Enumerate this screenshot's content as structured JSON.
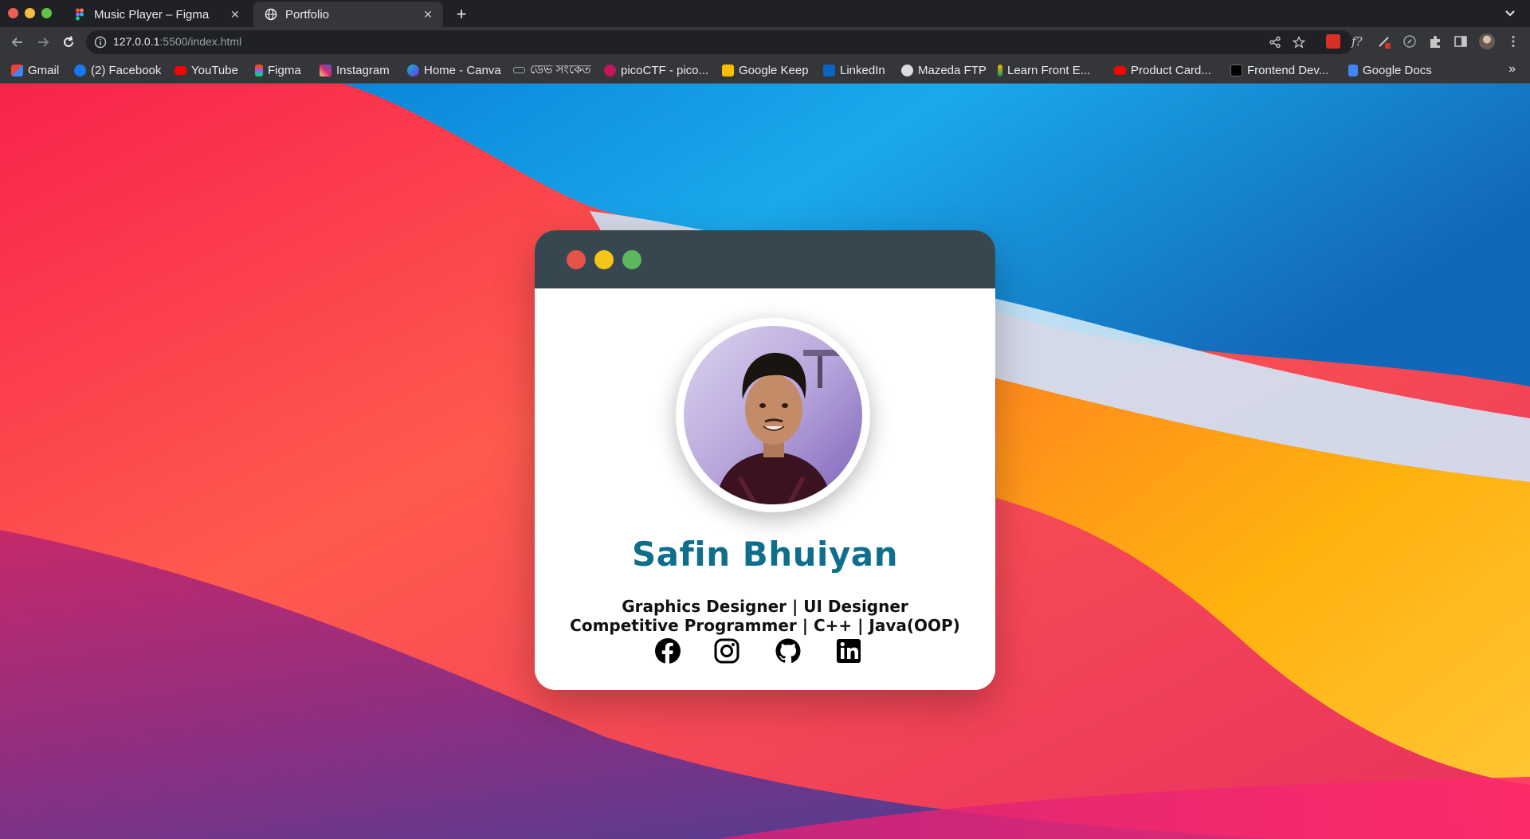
{
  "browser": {
    "tabs": [
      {
        "title": "Music Player – Figma",
        "icon": "figma-icon",
        "active": false
      },
      {
        "title": "Portfolio",
        "icon": "globe-icon",
        "active": true
      }
    ],
    "url_host": "127.0.0.1",
    "url_path": ":5500/index.html",
    "bookmarks": [
      {
        "label": "Gmail",
        "icon": "gmail-icon"
      },
      {
        "label": "(2) Facebook",
        "icon": "facebook-icon"
      },
      {
        "label": "YouTube",
        "icon": "youtube-icon"
      },
      {
        "label": "Figma",
        "icon": "figma-icon"
      },
      {
        "label": "Instagram",
        "icon": "instagram-icon"
      },
      {
        "label": "Home - Canva",
        "icon": "canva-icon"
      },
      {
        "label": "ডেভ সংকেত",
        "icon": "dev-icon"
      },
      {
        "label": "picoCTF - pico...",
        "icon": "picoctf-icon"
      },
      {
        "label": "Google Keep",
        "icon": "keep-icon"
      },
      {
        "label": "LinkedIn",
        "icon": "linkedin-icon"
      },
      {
        "label": "Mazeda FTP",
        "icon": "globe-icon"
      },
      {
        "label": "Learn Front E...",
        "icon": "learn-icon"
      },
      {
        "label": "Product Card...",
        "icon": "youtube-icon"
      },
      {
        "label": "Frontend Dev...",
        "icon": "frontendmentor-icon"
      },
      {
        "label": "Google Docs",
        "icon": "docs-icon"
      }
    ],
    "more_label": "»"
  },
  "card": {
    "name": "Safin Bhuiyan",
    "role_line1": "Graphics Designer | UI Designer",
    "role_line2": "Competitive Programmer | C++ | Java(OOP)",
    "socials": [
      "facebook-icon",
      "instagram-icon",
      "github-icon",
      "linkedin-icon"
    ],
    "colors": {
      "bar": "#37474f",
      "dot_red": "#e5534b",
      "dot_yellow": "#f5c518",
      "dot_green": "#5cb85c",
      "name": "#0f6e8c"
    }
  }
}
